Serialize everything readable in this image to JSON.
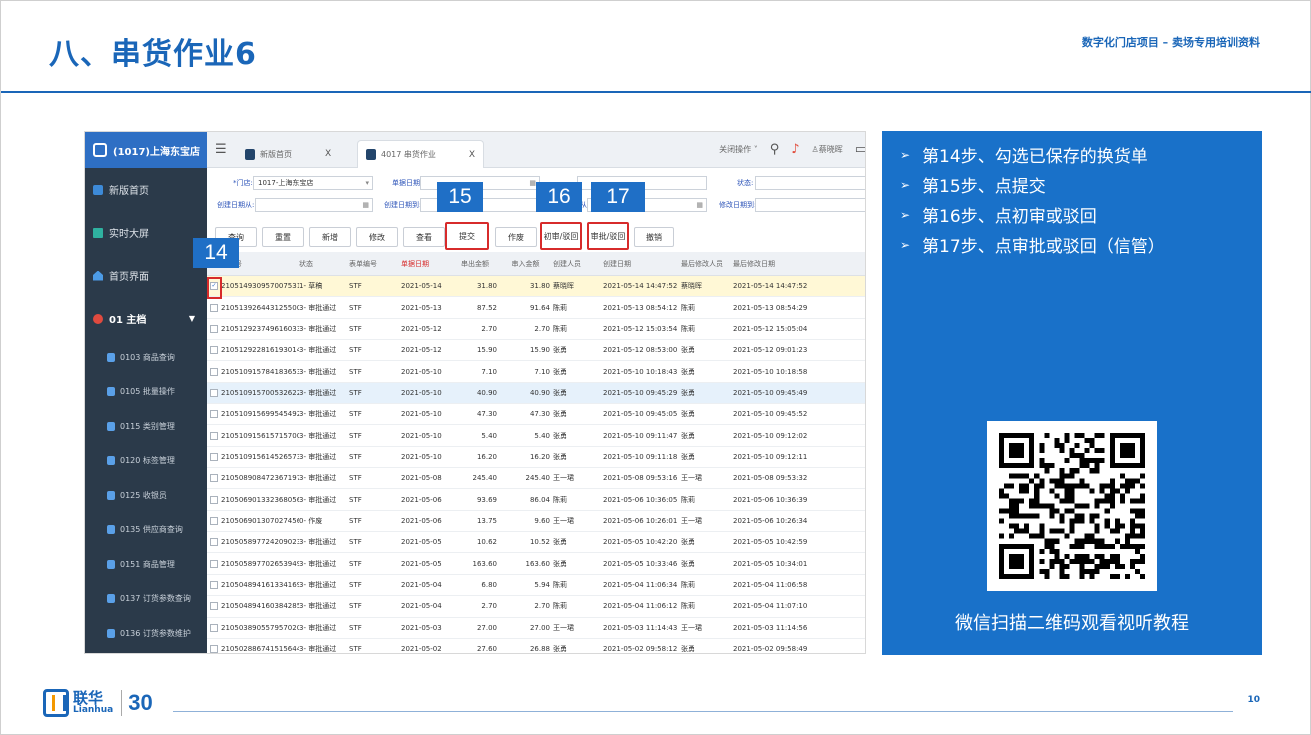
{
  "slide": {
    "title": "八、串货作业6",
    "subtitle": "数字化门店项目 – 卖场专用培训资料",
    "page_number": "10",
    "logo_cn": "联华",
    "logo_en": "Lianhua",
    "logo_anniv": "30"
  },
  "app": {
    "store": "(1017)上海东宝店",
    "sidebar": {
      "items": [
        {
          "label": "新版首页",
          "icon": "m-logo-icon"
        },
        {
          "label": "实时大屏",
          "icon": "screen-icon"
        },
        {
          "label": "首页界面",
          "icon": "home-icon"
        }
      ],
      "group": "01 主档",
      "sub": [
        "0103 商品查询",
        "0105 批量操作",
        "0115 类别管理",
        "0120 标签管理",
        "0125 收银员",
        "0135 供应商查询",
        "0151 商品管理",
        "0137 订货参数查询",
        "0136 订货参数维护"
      ]
    },
    "tabs": [
      {
        "label": "新版首页",
        "close": "X"
      },
      {
        "label": "4017 串货作业",
        "close": "X"
      }
    ],
    "topbar": {
      "close_ops": "关闭操作 ˅",
      "user": "蔡晓晖"
    },
    "filters": {
      "store_label": "*门店:",
      "store_value": "1017-上海东宝店",
      "bill_date_label": "单据日期:",
      "status_label": "状态:",
      "created_from_label": "创建日期从:",
      "created_to_label": "创建日期到:",
      "modified_from_label": "修改日期从:",
      "modified_to_label": "修改日期到:"
    },
    "toolbar": [
      "查询",
      "重置",
      "新增",
      "修改",
      "查看",
      "提交",
      "作废",
      "初审/驳回",
      "审批/驳回",
      "撤销"
    ],
    "columns": [
      "单据号",
      "状态",
      "表单编号",
      "单据日期",
      "串出金额",
      "串入金额",
      "创建人员",
      "创建日期",
      "最后修改人员",
      "最后修改日期"
    ],
    "rows": [
      [
        "210514930957007531...",
        "1- 草稿",
        "STF",
        "2021-05-14",
        "31.80",
        "31.80",
        "蔡晓晖",
        "2021-05-14 14:47:52",
        "蔡晓晖",
        "2021-05-14 14:47:52"
      ],
      [
        "210513926443125500...",
        "3- 审批通过",
        "STF",
        "2021-05-13",
        "87.52",
        "91.64",
        "陈莉",
        "2021-05-13 08:54:12",
        "陈莉",
        "2021-05-13 08:54:29"
      ],
      [
        "210512923749616033...",
        "3- 审批通过",
        "STF",
        "2021-05-12",
        "2.70",
        "2.70",
        "陈莉",
        "2021-05-12 15:03:54",
        "陈莉",
        "2021-05-12 15:05:04"
      ],
      [
        "210512922816193014...",
        "3- 审批通过",
        "STF",
        "2021-05-12",
        "15.90",
        "15.90",
        "张勇",
        "2021-05-12 08:53:00",
        "张勇",
        "2021-05-12 09:01:23"
      ],
      [
        "210510915784183653...",
        "3- 审批通过",
        "STF",
        "2021-05-10",
        "7.10",
        "7.10",
        "张勇",
        "2021-05-10 10:18:43",
        "张勇",
        "2021-05-10 10:18:58"
      ],
      [
        "210510915700532622...",
        "3- 审批通过",
        "STF",
        "2021-05-10",
        "40.90",
        "40.90",
        "张勇",
        "2021-05-10 09:45:29",
        "张勇",
        "2021-05-10 09:45:49"
      ],
      [
        "210510915699545492...",
        "3- 审批通过",
        "STF",
        "2021-05-10",
        "47.30",
        "47.30",
        "张勇",
        "2021-05-10 09:45:05",
        "张勇",
        "2021-05-10 09:45:52"
      ],
      [
        "210510915615715700...",
        "3- 审批通过",
        "STF",
        "2021-05-10",
        "5.40",
        "5.40",
        "张勇",
        "2021-05-10 09:11:47",
        "张勇",
        "2021-05-10 09:12:02"
      ],
      [
        "210510915614526573...",
        "3- 审批通过",
        "STF",
        "2021-05-10",
        "16.20",
        "16.20",
        "张勇",
        "2021-05-10 09:11:18",
        "张勇",
        "2021-05-10 09:12:11"
      ],
      [
        "210508908472367197...",
        "3- 审批通过",
        "STF",
        "2021-05-08",
        "245.40",
        "245.40",
        "王一珺",
        "2021-05-08 09:53:16",
        "王一珺",
        "2021-05-08 09:53:32"
      ],
      [
        "210506901332368056...",
        "3- 审批通过",
        "STF",
        "2021-05-06",
        "93.69",
        "86.04",
        "陈莉",
        "2021-05-06 10:36:05",
        "陈莉",
        "2021-05-06 10:36:39"
      ],
      [
        "210506901307027456...",
        "0- 作废",
        "STF",
        "2021-05-06",
        "13.75",
        "9.60",
        "王一珺",
        "2021-05-06 10:26:01",
        "王一珺",
        "2021-05-06 10:26:34"
      ],
      [
        "210505897724209023...",
        "3- 审批通过",
        "STF",
        "2021-05-05",
        "10.62",
        "10.52",
        "张勇",
        "2021-05-05 10:42:20",
        "张勇",
        "2021-05-05 10:42:59"
      ],
      [
        "210505897702653949...",
        "3- 审批通过",
        "STF",
        "2021-05-05",
        "163.60",
        "163.60",
        "张勇",
        "2021-05-05 10:33:46",
        "张勇",
        "2021-05-05 10:34:01"
      ],
      [
        "210504894161334169...",
        "3- 审批通过",
        "STF",
        "2021-05-04",
        "6.80",
        "5.94",
        "陈莉",
        "2021-05-04 11:06:34",
        "陈莉",
        "2021-05-04 11:06:58"
      ],
      [
        "210504894160384285...",
        "3- 审批通过",
        "STF",
        "2021-05-04",
        "2.70",
        "2.70",
        "陈莉",
        "2021-05-04 11:06:12",
        "陈莉",
        "2021-05-04 11:07:10"
      ],
      [
        "210503890557957020...",
        "3- 审批通过",
        "STF",
        "2021-05-03",
        "27.00",
        "27.00",
        "王一珺",
        "2021-05-03 11:14:43",
        "王一珺",
        "2021-05-03 11:14:56"
      ],
      [
        "210502886741515644...",
        "3- 审批通过",
        "STF",
        "2021-05-02",
        "27.60",
        "26.88",
        "张勇",
        "2021-05-02 09:58:12",
        "张勇",
        "2021-05-02 09:58:49"
      ]
    ]
  },
  "badges": [
    "14",
    "15",
    "16",
    "17"
  ],
  "panel": {
    "steps": [
      "第14步、勾选已保存的换货单",
      "第15步、点提交",
      "第16步、点初审或驳回",
      "第17步、点审批或驳回（信管）"
    ],
    "qr_caption": "微信扫描二维码观看视听教程"
  },
  "colors": {
    "brand_blue": "#1a66b8",
    "panel_blue": "#1971c9",
    "badge_blue": "#1f6fc6",
    "highlight_red": "#d72b2b",
    "sidebar": "#2b3a4a"
  }
}
